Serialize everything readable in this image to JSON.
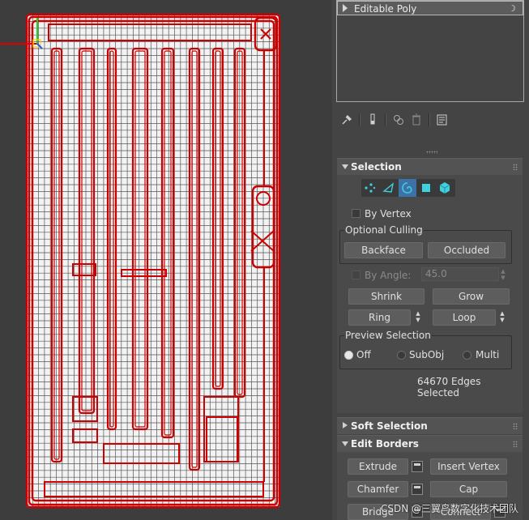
{
  "modifier_stack": {
    "item_label": "Editable Poly",
    "light_icon": "lightbulb-icon"
  },
  "toolbar": {
    "icons": [
      "pin-stack-icon",
      "show-end-result-icon",
      "make-unique-icon",
      "remove-modifier-icon",
      "configure-modifier-sets-icon"
    ]
  },
  "selection": {
    "title": "Selection",
    "subobject_icons": [
      "vertex-icon",
      "edge-icon",
      "border-icon",
      "polygon-icon",
      "element-icon"
    ],
    "active_subobject": "border-icon",
    "by_vertex_label": "By Vertex",
    "optional_culling_label": "Optional Culling",
    "backface_label": "Backface",
    "occluded_label": "Occluded",
    "by_angle_label": "By Angle:",
    "by_angle_value": "45.0",
    "shrink_label": "Shrink",
    "grow_label": "Grow",
    "ring_label": "Ring",
    "loop_label": "Loop",
    "preview_selection_label": "Preview Selection",
    "preview_options": [
      "Off",
      "SubObj",
      "Multi"
    ],
    "preview_selected": "Off",
    "status": "64670 Edges Selected"
  },
  "soft_selection": {
    "title": "Soft Selection"
  },
  "edit_borders": {
    "title": "Edit Borders",
    "extrude_label": "Extrude",
    "insert_vertex_label": "Insert Vertex",
    "chamfer_label": "Chamfer",
    "cap_label": "Cap",
    "bridge_label": "Bridge",
    "connect_label": "Connect"
  },
  "watermark": "CSDN @三翼鸟数字化技术团队",
  "colors": {
    "viewport_bg": "#3d3d3d",
    "wire": "#ffffff",
    "selection_red": "#cc0000",
    "panel_bg": "#444444",
    "active_blue": "#3b73a8",
    "gizmo_x": "#e00000",
    "gizmo_y": "#1fd01f",
    "gizmo_z": "#2255ff"
  }
}
